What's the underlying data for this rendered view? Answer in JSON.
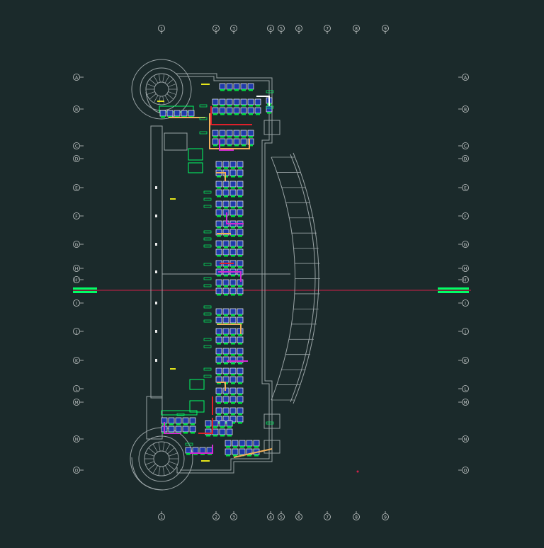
{
  "colors": {
    "background": "#1b2a2b",
    "wall": "#9aa4a6",
    "grid_line": "#c8cccc",
    "section_line": "#d1204a",
    "desk_fill": "#1f3aa8",
    "desk_outline": "#ffffff",
    "chair": "#00e040",
    "label_green": "#00ff66",
    "label_yellow": "#e6e61a",
    "power_red": "#e0202a",
    "power_orange": "#f2b05a",
    "power_magenta": "#d02ad0"
  },
  "grid": {
    "columns": [
      "1",
      "2",
      "3",
      "4",
      "5",
      "6",
      "7",
      "8",
      "9"
    ],
    "rows": [
      "A",
      "B",
      "C",
      "D",
      "E",
      "F",
      "G",
      "H",
      "H'",
      "I",
      "J",
      "K",
      "L",
      "M",
      "N",
      "O"
    ]
  }
}
